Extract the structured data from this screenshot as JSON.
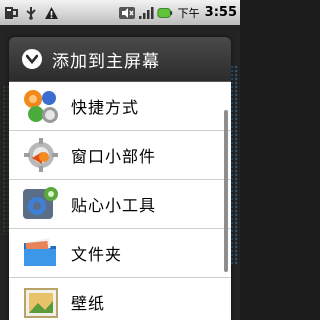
{
  "status_bar": {
    "time": "3:55",
    "ampm": "下午",
    "icons": [
      "usb-debug-icon",
      "usb-icon",
      "warning-icon",
      "muted-icon",
      "signal-icon",
      "battery-icon"
    ]
  },
  "dialog": {
    "title": "添加到主屏幕",
    "items": [
      {
        "label": "快捷方式",
        "icon": "shortcut-icon"
      },
      {
        "label": "窗口小部件",
        "icon": "widget-icon"
      },
      {
        "label": "贴心小工具",
        "icon": "tools-icon"
      },
      {
        "label": "文件夹",
        "icon": "folder-icon"
      },
      {
        "label": "壁纸",
        "icon": "wallpaper-icon"
      }
    ]
  }
}
